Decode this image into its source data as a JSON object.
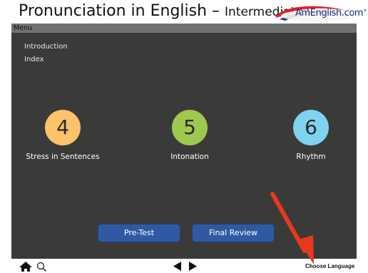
{
  "header": {
    "title": "Pronunciation in English –",
    "subtitle": "Intermediate+",
    "logo_text": "AmEnglish.com",
    "logo_mark": "®"
  },
  "menu": {
    "label": "Menu"
  },
  "nav": [
    {
      "label": "Introduction"
    },
    {
      "label": "Index"
    }
  ],
  "units": [
    {
      "number": "4",
      "label": "Stress in Sentences",
      "color": "#fdc26a"
    },
    {
      "number": "5",
      "label": "Intonation",
      "color": "#9fc84e"
    },
    {
      "number": "6",
      "label": "Rhythm",
      "color": "#7ed3ef"
    }
  ],
  "buttons": {
    "pretest": "Pre-Test",
    "final_review": "Final Review"
  },
  "footer": {
    "choose_language": "Choose Language"
  },
  "icons": {
    "home": "home-icon",
    "search": "search-icon",
    "prev": "previous-arrow-icon",
    "next": "next-arrow-icon",
    "annotation": "red-arrow-annotation"
  },
  "colors": {
    "panel": "#3a3a39",
    "button": "#2f5aa3",
    "arrow": "#e8391c"
  }
}
